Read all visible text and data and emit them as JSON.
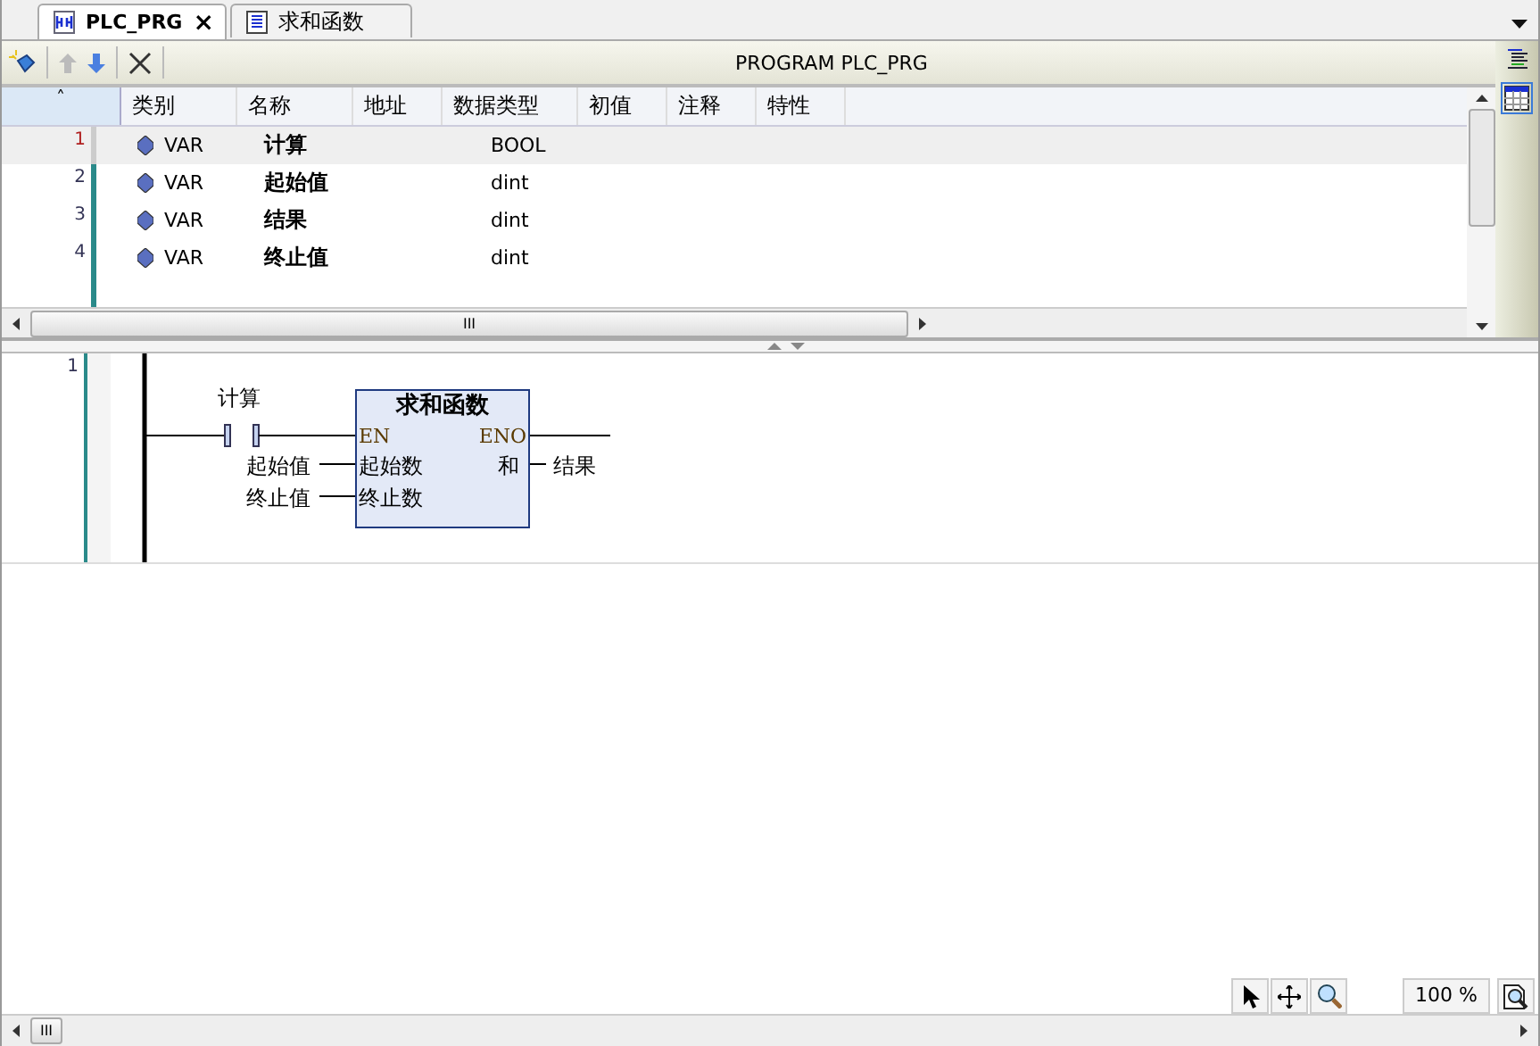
{
  "tabs": [
    {
      "label": "PLC_PRG",
      "selected": true,
      "kind": "program",
      "close": "×"
    },
    {
      "label": "求和函数",
      "selected": false,
      "kind": "function"
    }
  ],
  "toolbar": {
    "title": "PROGRAM PLC_PRG"
  },
  "table": {
    "sort_mark": "˄",
    "columns": [
      "类别",
      "名称",
      "地址",
      "数据类型",
      "初值",
      "注释",
      "特性"
    ],
    "rows": [
      {
        "line": "1",
        "scope": "VAR",
        "name": "计算",
        "address": "",
        "type": "BOOL",
        "selected": true
      },
      {
        "line": "2",
        "scope": "VAR",
        "name": "起始值",
        "type": "dint",
        "selected": false
      },
      {
        "line": "3",
        "scope": "VAR",
        "name": "结果",
        "type": "dint",
        "selected": false
      },
      {
        "line": "4",
        "scope": "VAR",
        "name": "终止值",
        "type": "dint",
        "selected": false
      }
    ],
    "hscroll_grip": "III"
  },
  "network": {
    "line": "1",
    "contact": "计算",
    "block": {
      "title": "求和函数",
      "en": "EN",
      "eno": "ENO",
      "inputs": [
        {
          "pin": "起始数",
          "variable": "起始值"
        },
        {
          "pin": "终止数",
          "variable": "终止值"
        }
      ],
      "outputs": [
        {
          "pin": "和",
          "variable": "结果"
        }
      ]
    }
  },
  "status": {
    "zoom": "100 %",
    "hscroll_grip": "III"
  }
}
